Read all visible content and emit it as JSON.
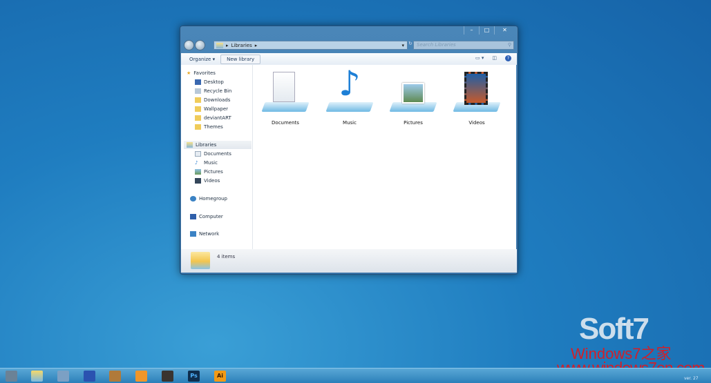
{
  "window": {
    "controls": [
      "–",
      "□",
      "✕"
    ],
    "address": {
      "path": "Libraries",
      "arrow": "▸"
    },
    "search_placeholder": "Search Libraries",
    "toolbar": {
      "organize": "Organize ▾",
      "new_library": "New library"
    },
    "sidebar": {
      "favorites": {
        "label": "Favorites",
        "items": [
          "Desktop",
          "Recycle Bin",
          "Downloads",
          "Wallpaper",
          "deviantART",
          "Themes"
        ]
      },
      "libraries": {
        "label": "Libraries",
        "items": [
          "Documents",
          "Music",
          "Pictures",
          "Videos"
        ]
      },
      "homegroup": "Homegroup",
      "computer": "Computer",
      "network": "Network"
    },
    "libraries": [
      {
        "label": "Documents",
        "icon": "documents-library-icon"
      },
      {
        "label": "Music",
        "icon": "music-library-icon"
      },
      {
        "label": "Pictures",
        "icon": "pictures-library-icon"
      },
      {
        "label": "Videos",
        "icon": "videos-library-icon"
      }
    ],
    "status": {
      "count": "4 items"
    }
  },
  "taskbar": {
    "items": [
      "start",
      "explorer",
      "app",
      "app",
      "app",
      "media-player",
      "app",
      "Ps",
      "Ai"
    ]
  },
  "watermark": {
    "brand": "Soft7",
    "line1": "Windows7之家",
    "line2": "www.windows7en.com",
    "version": "ver. 27"
  }
}
